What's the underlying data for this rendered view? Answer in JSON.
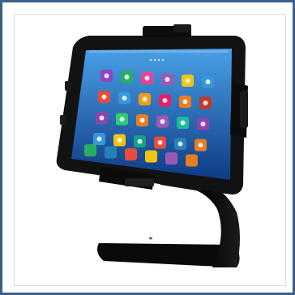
{
  "image": {
    "subject": "tablet-on-desk-stand",
    "colors": {
      "frame_border": "#3a5f8a",
      "stand": "#0b0b0b",
      "tablet_bezel": "#111111",
      "screen_top": "#3f8fd6",
      "screen_bottom": "#0f3d86"
    },
    "app_icon_colors": [
      [
        "#8e44c9",
        "#27ae60",
        "#e84393",
        "#9b59b6",
        "#f1c40f",
        "#3498db"
      ],
      [
        "#e74c3c",
        "#3498db",
        "#f39c12",
        "#e91e63",
        "#e67e22",
        "#c0392b"
      ],
      [
        "#8e44ad",
        "#2ecc71",
        "#e67e22",
        "#9b59b6",
        "#1abc9c",
        "#8e44ad"
      ],
      [
        "#3498db",
        "#f1c40f",
        "#16a085",
        "#e74c3c",
        "#2980b9",
        "#e67e22"
      ]
    ],
    "dock_icon_colors": [
      "#27ae60",
      "#2980b9",
      "#e74c3c",
      "#f1c40f",
      "#9b59b6",
      "#e67e22"
    ]
  }
}
